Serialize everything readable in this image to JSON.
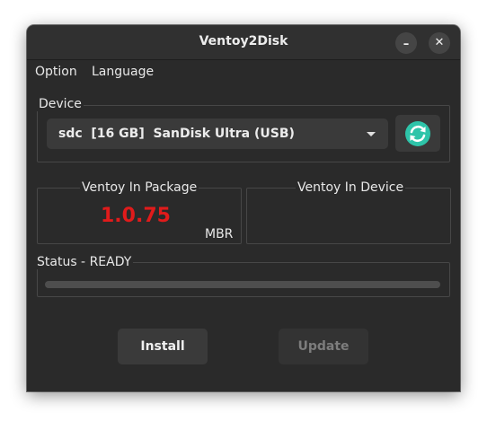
{
  "window": {
    "title": "Ventoy2Disk",
    "minimize_symbol": "–",
    "close_symbol": "✕"
  },
  "menu": {
    "items": [
      "Option",
      "Language"
    ]
  },
  "device": {
    "label": "Device",
    "selected": "sdc  [16 GB]  SanDisk Ultra (USB)",
    "refresh_icon": "refresh-icon"
  },
  "package": {
    "label": "Ventoy In Package",
    "version": "1.0.75",
    "partition_style": "MBR",
    "version_color": "#e01b1b"
  },
  "in_device": {
    "label": "Ventoy In Device",
    "version": ""
  },
  "status": {
    "label": "Status - READY",
    "progress": 0
  },
  "buttons": {
    "install": "Install",
    "update": "Update",
    "update_enabled": false
  },
  "colors": {
    "accent": "#3584e4",
    "refresh_icon": "#2ec4a9"
  }
}
